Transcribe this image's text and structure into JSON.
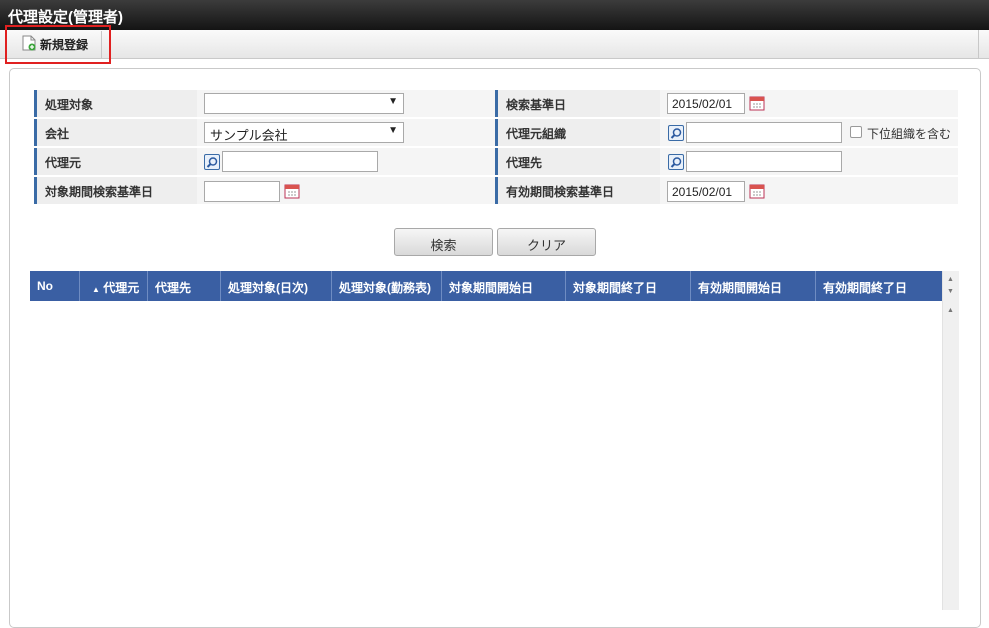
{
  "title": "代理設定(管理者)",
  "toolbar": {
    "new_label": "新規登録"
  },
  "form": {
    "target_label": "処理対象",
    "target_value": "",
    "search_date_label": "検索基準日",
    "search_date_value": "2015/02/01",
    "company_label": "会社",
    "company_value": "サンプル会社",
    "source_org_label": "代理元組織",
    "source_org_value": "",
    "include_sub_label": "下位組織を含む",
    "include_sub_checked": false,
    "source_label": "代理元",
    "source_value": "",
    "dest_label": "代理先",
    "dest_value": "",
    "period_date_label": "対象期間検索基準日",
    "period_date_value": "",
    "valid_date_label": "有効期間検索基準日",
    "valid_date_value": "2015/02/01"
  },
  "buttons": {
    "search": "検索",
    "clear": "クリア"
  },
  "table": {
    "sort_indicator": "▲",
    "columns": [
      "No",
      "代理元",
      "代理先",
      "処理対象(日次)",
      "処理対象(勤務表)",
      "対象期間開始日",
      "対象期間終了日",
      "有効期間開始日",
      "有効期間終了日"
    ],
    "rows": []
  },
  "colors": {
    "header_blue": "#3a5fa3",
    "label_accent": "#3a6ba6",
    "highlight_red": "#e02020"
  }
}
